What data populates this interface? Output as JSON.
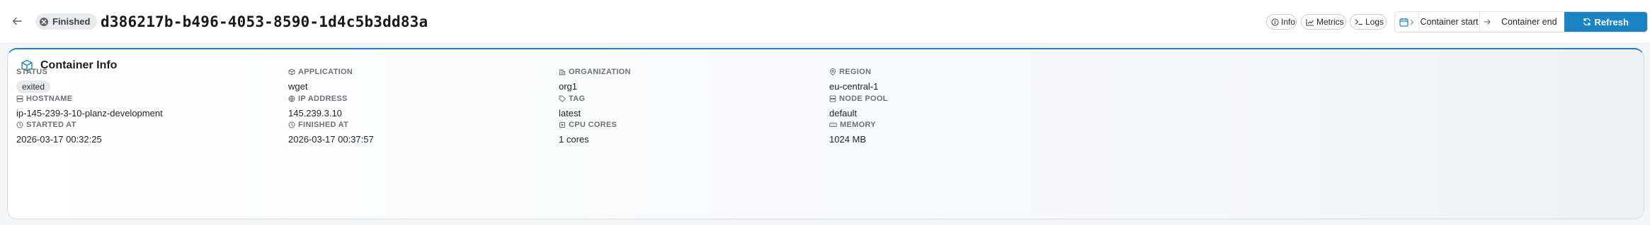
{
  "header": {
    "status": "Finished",
    "container_id": "d386217b-b496-4053-8590-1d4c5b3dd83a",
    "chips": {
      "info": "Info",
      "metrics": "Metrics",
      "logs": "Logs"
    },
    "range": {
      "start": "Container start",
      "end": "Container end"
    },
    "refresh_label": "Refresh",
    "accent_color": "#1a83c4"
  },
  "card": {
    "title": "Container Info",
    "icon": "cube-icon",
    "fields": {
      "status": {
        "label": "STATUS",
        "value": "exited"
      },
      "application": {
        "label": "APPLICATION",
        "value": "wget"
      },
      "organization": {
        "label": "ORGANIZATION",
        "value": "org1"
      },
      "region": {
        "label": "REGION",
        "value": "eu-central-1"
      },
      "hostname": {
        "label": "HOSTNAME",
        "value": "ip-145-239-3-10-planz-development"
      },
      "ip_address": {
        "label": "IP ADDRESS",
        "value": "145.239.3.10"
      },
      "tag": {
        "label": "TAG",
        "value": "latest"
      },
      "node_pool": {
        "label": "NODE POOL",
        "value": "default"
      },
      "started_at": {
        "label": "STARTED AT",
        "value": "2026-03-17 00:32:25"
      },
      "finished_at": {
        "label": "FINISHED AT",
        "value": "2026-03-17 00:37:57"
      },
      "cpu_cores": {
        "label": "CPU CORES",
        "value": "1 cores"
      },
      "memory": {
        "label": "MEMORY",
        "value": "1024 MB"
      }
    }
  }
}
